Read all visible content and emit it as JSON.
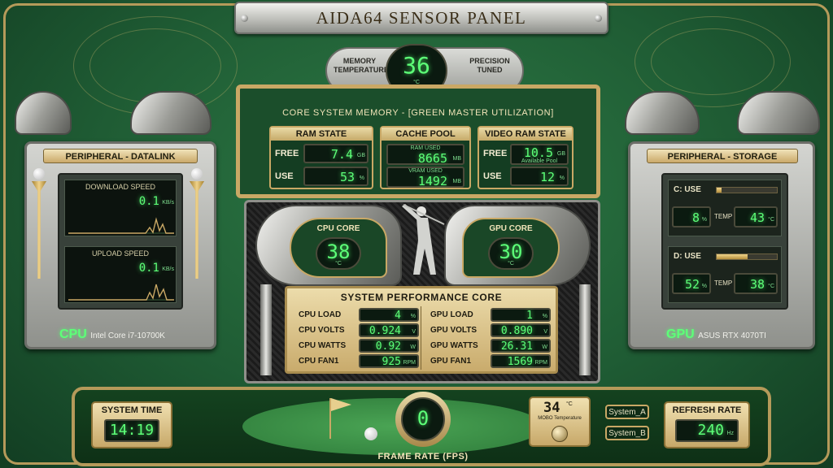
{
  "title": "AIDA64 SENSOR PANEL",
  "memory_temperature": {
    "label": "MEMORY TEMPERATURE",
    "value": "36",
    "unit": "°C",
    "right_label": "PRECISION TUNED"
  },
  "core_memory": {
    "title": "CORE SYSTEM MEMORY - [GREEN MASTER UTILIZATION]",
    "ram": {
      "title": "RAM STATE",
      "free_label": "FREE",
      "free_value": "7.4",
      "free_unit": "GB",
      "use_label": "USE",
      "use_value": "53",
      "use_unit": "%"
    },
    "cache": {
      "title": "CACHE POOL",
      "ram_used_label": "RAM USED",
      "ram_used_value": "8665",
      "ram_used_unit": "MB",
      "vram_used_label": "VRAM USED",
      "vram_used_value": "1492",
      "vram_used_unit": "MB"
    },
    "vram": {
      "title": "VIDEO RAM STATE",
      "free_label": "FREE",
      "free_value": "10.5",
      "free_unit": "GB",
      "free_sub": "Available Pool",
      "use_label": "USE",
      "use_value": "12",
      "use_unit": "%"
    }
  },
  "left_panel": {
    "title": "PERIPHERAL - DATALINK",
    "download_label": "DOWNLOAD SPEED",
    "download_value": "0.1",
    "download_unit": "KB/s",
    "upload_label": "UPLOAD SPEED",
    "upload_value": "0.1",
    "upload_unit": "KB/s",
    "footer_brand": "CPU",
    "footer_model": "Intel Core i7-10700K"
  },
  "right_panel": {
    "title": "PERIPHERAL - STORAGE",
    "c_label": "C: USE",
    "c_use": "8",
    "c_use_unit": "%",
    "c_fill": 0.08,
    "c_temp_label": "TEMP",
    "c_temp": "43",
    "c_temp_unit": "°C",
    "d_label": "D: USE",
    "d_use": "52",
    "d_use_unit": "%",
    "d_fill": 0.52,
    "d_temp_label": "TEMP",
    "d_temp": "38",
    "d_temp_unit": "°C",
    "footer_brand": "GPU",
    "footer_model": "ASUS RTX 4070TI"
  },
  "cpu_core": {
    "label": "CPU CORE",
    "value": "38",
    "unit": "°C"
  },
  "gpu_core": {
    "label": "GPU CORE",
    "value": "30",
    "unit": "°C"
  },
  "performance": {
    "title": "SYSTEM PERFORMANCE CORE",
    "cpu": [
      {
        "label": "CPU LOAD",
        "value": "4",
        "unit": "%"
      },
      {
        "label": "CPU VOLTS",
        "value": "0.924",
        "unit": "V"
      },
      {
        "label": "CPU WATTS",
        "value": "0.92",
        "unit": "W"
      },
      {
        "label": "CPU FAN1",
        "value": "925",
        "unit": "RPM"
      }
    ],
    "gpu": [
      {
        "label": "GPU LOAD",
        "value": "1",
        "unit": "%"
      },
      {
        "label": "GPU VOLTS",
        "value": "0.890",
        "unit": "V"
      },
      {
        "label": "GPU WATTS",
        "value": "26.31",
        "unit": "W"
      },
      {
        "label": "GPU FAN1",
        "value": "1569",
        "unit": "RPM"
      }
    ]
  },
  "bottom": {
    "system_time_label": "SYSTEM TIME",
    "system_time": "14:19",
    "fps_value": "0",
    "fps_label": "FRAME RATE (FPS)",
    "mobo_temp": "34",
    "mobo_temp_unit": "°C",
    "mobo_label": "MOBO Temperature",
    "system_a": "System_A",
    "system_b": "System_B",
    "refresh_label": "REFRESH RATE",
    "refresh_value": "240",
    "refresh_unit": "Hz"
  },
  "colors": {
    "felt_green": "#1f5c34",
    "gold": "#c9a865",
    "lcd_green": "#5dff78"
  }
}
